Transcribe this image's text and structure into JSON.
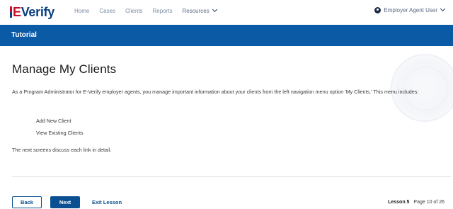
{
  "header": {
    "logo_text": "Verify",
    "logo_prefix": "E",
    "nav": [
      {
        "label": "Home"
      },
      {
        "label": "Cases"
      },
      {
        "label": "Clients"
      },
      {
        "label": "Reports"
      },
      {
        "label": "Resources"
      }
    ],
    "user_label": "Employer Agent User"
  },
  "banner": {
    "title": "Tutorial"
  },
  "main": {
    "title": "Manage My Clients",
    "intro": "As a Program Administrator for E-Verify employer agents, you manage important information about your clients from the left navigation menu option 'My Clients.' This menu includes:",
    "links": [
      "Add New Client",
      "View Existing Clients"
    ],
    "closing": "The next screens discuss each link in detail."
  },
  "footer": {
    "back_label": "Back",
    "next_label": "Next",
    "exit_label": "Exit Lesson",
    "lesson_label": "Lesson 5",
    "page_label": "Page 10 of 26"
  },
  "colors": {
    "brand_blue": "#0a5aa6",
    "button_blue": "#0a4f91",
    "logo_red": "#c8102e"
  }
}
